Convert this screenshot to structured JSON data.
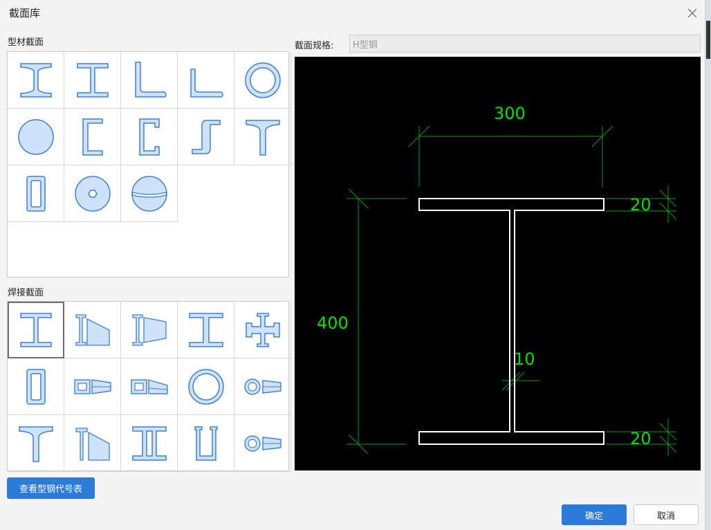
{
  "dialog": {
    "title": "截面库"
  },
  "sections": {
    "profile_label": "型材截面",
    "welded_label": "焊接截面"
  },
  "profile_items": [
    "i-beam-icon",
    "h-beam-icon",
    "equal-angle-icon",
    "unequal-angle-icon",
    "circular-tube-icon",
    "solid-round-icon",
    "channel-icon",
    "lipped-channel-icon",
    "z-section-icon",
    "t-section-icon",
    "rectangular-tube-icon",
    "hex-bolt-icon",
    "bulb-round-icon"
  ],
  "welded_items": [
    "welded-i-beam-icon",
    "tapered-i-beam-icon",
    "tapered-i-beam-alt-icon",
    "welded-h-beam-icon",
    "cross-section-icon",
    "welded-box-icon",
    "tapered-box-icon",
    "tapered-box-alt-icon",
    "welded-circular-tube-icon",
    "tapered-tube-icon",
    "welded-t-icon",
    "tapered-t-icon",
    "double-i-icon",
    "u-section-icon",
    "tapered-tube-alt-icon"
  ],
  "spec": {
    "label": "截面规格:",
    "value": "H型钢"
  },
  "drawing": {
    "width": "300",
    "height": "400",
    "top_flange": "20",
    "bottom_flange": "20",
    "web": "10",
    "line_color": "#ffffff",
    "dim_color": "#0f9d0f",
    "text_color": "#00e000"
  },
  "buttons": {
    "table": "查看型钢代号表",
    "ok": "确定",
    "cancel": "取消"
  },
  "colors": {
    "primary": "#2b7bdc",
    "icon_fill": "#cfe2fb",
    "icon_stroke": "#3f7fd0"
  }
}
